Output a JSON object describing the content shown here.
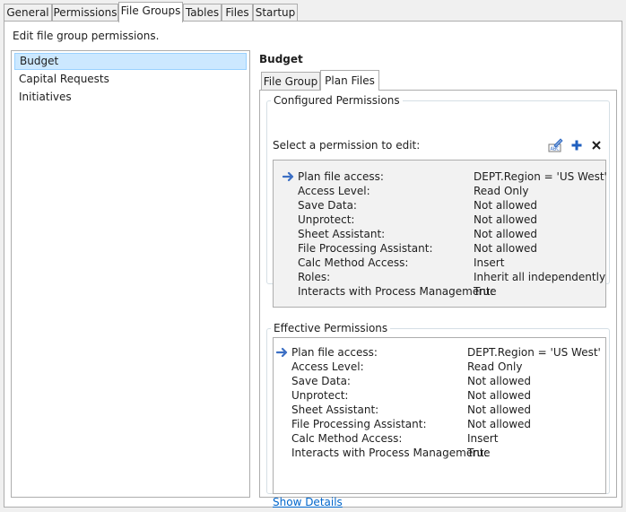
{
  "tabs": [
    "General",
    "Permissions",
    "File Groups",
    "Tables",
    "Files",
    "Startup"
  ],
  "active_tab": "File Groups",
  "description": "Edit file group permissions.",
  "file_groups": [
    "Budget",
    "Capital Requests",
    "Initiatives"
  ],
  "selected_group": "Budget",
  "group_title": "Budget",
  "sub_tabs": [
    "File Group",
    "Plan Files"
  ],
  "active_sub_tab": "Plan Files",
  "configured": {
    "legend": "Configured Permissions",
    "prompt": "Select a permission to edit:",
    "toolbar": {
      "edit_icon": "edit-text-icon",
      "add_icon": "plus-icon",
      "delete_icon": "close-icon",
      "icon_color": "#1f5fbf"
    },
    "rows": [
      {
        "label": "Plan file access:",
        "value": "DEPT.Region = 'US West'"
      },
      {
        "label": "Access Level:",
        "value": "Read Only"
      },
      {
        "label": "Save Data:",
        "value": "Not allowed"
      },
      {
        "label": "Unprotect:",
        "value": "Not allowed"
      },
      {
        "label": "Sheet Assistant:",
        "value": "Not allowed"
      },
      {
        "label": "File Processing Assistant:",
        "value": "Not allowed"
      },
      {
        "label": "Calc Method Access:",
        "value": "Insert"
      },
      {
        "label": "Roles:",
        "value": "Inherit all independently"
      },
      {
        "label": "Interacts with Process Management:",
        "value": "True"
      }
    ]
  },
  "effective": {
    "legend": "Effective Permissions",
    "rows": [
      {
        "label": "Plan file access:",
        "value": "DEPT.Region = 'US West'"
      },
      {
        "label": "Access Level:",
        "value": "Read Only"
      },
      {
        "label": "Save Data:",
        "value": "Not allowed"
      },
      {
        "label": "Unprotect:",
        "value": "Not allowed"
      },
      {
        "label": "Sheet Assistant:",
        "value": "Not allowed"
      },
      {
        "label": "File Processing Assistant:",
        "value": "Not allowed"
      },
      {
        "label": "Calc Method Access:",
        "value": "Insert"
      },
      {
        "label": "Interacts with Process Management:",
        "value": "True"
      }
    ]
  },
  "show_details_label": "Show Details",
  "colors": {
    "selection_bg": "#cce8ff",
    "selection_border": "#99d1ff",
    "arrow": "#3c6fc4",
    "link": "#0066cc",
    "configured_box_bg": "#f2f2f2"
  }
}
